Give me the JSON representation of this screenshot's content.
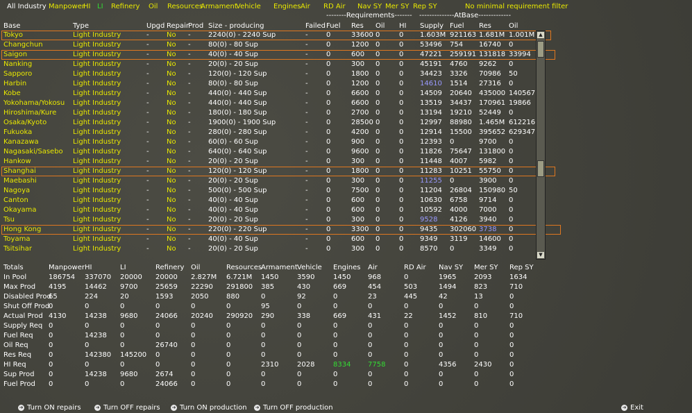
{
  "filter": {
    "all_industry": "All Industry",
    "manpower": "Manpower",
    "hi": "HI",
    "li": "LI",
    "refinery": "Refinery",
    "oil": "Oil",
    "resources": "Resources",
    "armament": "Armament",
    "vehicle": "Vehicle",
    "engines": "Engines",
    "air": "Air",
    "rd_air": "RD Air",
    "nav_sy": "Nav SY",
    "mer_sy": "Mer SY",
    "rep_sy": "Rep SY",
    "min_req": "No minimal requirement filter"
  },
  "groups": {
    "requirements": "--------Requirements-------",
    "atbase": "--------------AtBase-------------"
  },
  "headers": [
    "Base",
    "Type",
    "Upgd",
    "Repair",
    "Prod",
    "Size - producing",
    "Failed",
    "Fuel",
    "Res",
    "Oil",
    "HI",
    "Supply",
    "Fuel",
    "Res",
    "Oil"
  ],
  "rows": [
    {
      "base": "Tokyo",
      "type": "Light Industry",
      "upgd": "-",
      "repair": "No",
      "prod": "-",
      "size": "2240(0) - 2240 Sup",
      "failed": "-",
      "fuel": "0",
      "res": "33600",
      "oil": "0",
      "hi": "0",
      "supply": "1.603M",
      "afuel": "921163",
      "ares": "1.681M",
      "aoil": "1.001M",
      "sel": true
    },
    {
      "base": "Changchun",
      "type": "Light Industry",
      "upgd": "-",
      "repair": "No",
      "prod": "-",
      "size": "80(0) - 80 Sup",
      "failed": "-",
      "fuel": "0",
      "res": "1200",
      "oil": "0",
      "hi": "0",
      "supply": "53496",
      "afuel": "754",
      "ares": "16740",
      "aoil": "0"
    },
    {
      "base": "Saigon",
      "type": "Light Industry",
      "upgd": "-",
      "repair": "No",
      "prod": "-",
      "size": "40(0) - 40 Sup",
      "failed": "-",
      "fuel": "0",
      "res": "600",
      "oil": "0",
      "hi": "0",
      "supply": "47221",
      "afuel": "259191",
      "ares": "131818",
      "aoil": "33994",
      "sel": true
    },
    {
      "base": "Nanking",
      "type": "Light Industry",
      "upgd": "-",
      "repair": "No",
      "prod": "-",
      "size": "20(0) - 20 Sup",
      "failed": "-",
      "fuel": "0",
      "res": "300",
      "oil": "0",
      "hi": "0",
      "supply": "45191",
      "afuel": "4760",
      "ares": "9262",
      "aoil": "0"
    },
    {
      "base": "Sapporo",
      "type": "Light Industry",
      "upgd": "-",
      "repair": "No",
      "prod": "-",
      "size": "120(0) - 120 Sup",
      "failed": "-",
      "fuel": "0",
      "res": "1800",
      "oil": "0",
      "hi": "0",
      "supply": "34423",
      "afuel": "3326",
      "ares": "70986",
      "aoil": "50"
    },
    {
      "base": "Harbin",
      "type": "Light Industry",
      "upgd": "-",
      "repair": "No",
      "prod": "-",
      "size": "80(0) - 80 Sup",
      "failed": "-",
      "fuel": "0",
      "res": "1200",
      "oil": "0",
      "hi": "0",
      "supply": "14610",
      "afuel": "1514",
      "ares": "27316",
      "aoil": "0",
      "supply_blue": true
    },
    {
      "base": "Kobe",
      "type": "Light Industry",
      "upgd": "-",
      "repair": "No",
      "prod": "-",
      "size": "440(0) - 440 Sup",
      "failed": "-",
      "fuel": "0",
      "res": "6600",
      "oil": "0",
      "hi": "0",
      "supply": "14509",
      "afuel": "20640",
      "ares": "435000",
      "aoil": "140567"
    },
    {
      "base": "Yokohama/Yokosu",
      "type": "Light Industry",
      "upgd": "-",
      "repair": "No",
      "prod": "-",
      "size": "440(0) - 440 Sup",
      "failed": "-",
      "fuel": "0",
      "res": "6600",
      "oil": "0",
      "hi": "0",
      "supply": "13519",
      "afuel": "34437",
      "ares": "170961",
      "aoil": "19866"
    },
    {
      "base": "Hiroshima/Kure",
      "type": "Light Industry",
      "upgd": "-",
      "repair": "No",
      "prod": "-",
      "size": "180(0) - 180 Sup",
      "failed": "-",
      "fuel": "0",
      "res": "2700",
      "oil": "0",
      "hi": "0",
      "supply": "13194",
      "afuel": "19210",
      "ares": "52449",
      "aoil": "0"
    },
    {
      "base": "Osaka/Kyoto",
      "type": "Light Industry",
      "upgd": "-",
      "repair": "No",
      "prod": "-",
      "size": "1900(0) - 1900 Sup",
      "failed": "-",
      "fuel": "0",
      "res": "28500",
      "oil": "0",
      "hi": "0",
      "supply": "12997",
      "afuel": "88980",
      "ares": "1.465M",
      "aoil": "612216"
    },
    {
      "base": "Fukuoka",
      "type": "Light Industry",
      "upgd": "-",
      "repair": "No",
      "prod": "-",
      "size": "280(0) - 280 Sup",
      "failed": "-",
      "fuel": "0",
      "res": "4200",
      "oil": "0",
      "hi": "0",
      "supply": "12914",
      "afuel": "15500",
      "ares": "395652",
      "aoil": "629347"
    },
    {
      "base": "Kanazawa",
      "type": "Light Industry",
      "upgd": "-",
      "repair": "No",
      "prod": "-",
      "size": "60(0) - 60 Sup",
      "failed": "-",
      "fuel": "0",
      "res": "900",
      "oil": "0",
      "hi": "0",
      "supply": "12393",
      "afuel": "0",
      "ares": "9700",
      "aoil": "0"
    },
    {
      "base": "Nagasaki/Sasebo",
      "type": "Light Industry",
      "upgd": "-",
      "repair": "No",
      "prod": "-",
      "size": "640(0) - 640 Sup",
      "failed": "-",
      "fuel": "0",
      "res": "9600",
      "oil": "0",
      "hi": "0",
      "supply": "11826",
      "afuel": "75647",
      "ares": "131800",
      "aoil": "0"
    },
    {
      "base": "Hankow",
      "type": "Light Industry",
      "upgd": "-",
      "repair": "No",
      "prod": "-",
      "size": "20(0) - 20 Sup",
      "failed": "-",
      "fuel": "0",
      "res": "300",
      "oil": "0",
      "hi": "0",
      "supply": "11448",
      "afuel": "4007",
      "ares": "5982",
      "aoil": "0"
    },
    {
      "base": "Shanghai",
      "type": "Light Industry",
      "upgd": "-",
      "repair": "No",
      "prod": "-",
      "size": "120(0) - 120 Sup",
      "failed": "-",
      "fuel": "0",
      "res": "1800",
      "oil": "0",
      "hi": "0",
      "supply": "11283",
      "afuel": "10251",
      "ares": "55750",
      "aoil": "0",
      "sel": true
    },
    {
      "base": "Maebashi",
      "type": "Light Industry",
      "upgd": "-",
      "repair": "No",
      "prod": "-",
      "size": "20(0) - 20 Sup",
      "failed": "-",
      "fuel": "0",
      "res": "300",
      "oil": "0",
      "hi": "0",
      "supply": "11255",
      "afuel": "0",
      "ares": "3900",
      "aoil": "0",
      "supply_blue": true
    },
    {
      "base": "Nagoya",
      "type": "Light Industry",
      "upgd": "-",
      "repair": "No",
      "prod": "-",
      "size": "500(0) - 500 Sup",
      "failed": "-",
      "fuel": "0",
      "res": "7500",
      "oil": "0",
      "hi": "0",
      "supply": "11204",
      "afuel": "26804",
      "ares": "150980",
      "aoil": "50"
    },
    {
      "base": "Canton",
      "type": "Light Industry",
      "upgd": "-",
      "repair": "No",
      "prod": "-",
      "size": "40(0) - 40 Sup",
      "failed": "-",
      "fuel": "0",
      "res": "600",
      "oil": "0",
      "hi": "0",
      "supply": "10630",
      "afuel": "6758",
      "ares": "9714",
      "aoil": "0"
    },
    {
      "base": "Okayama",
      "type": "Light Industry",
      "upgd": "-",
      "repair": "No",
      "prod": "-",
      "size": "40(0) - 40 Sup",
      "failed": "-",
      "fuel": "0",
      "res": "600",
      "oil": "0",
      "hi": "0",
      "supply": "10592",
      "afuel": "4000",
      "ares": "7000",
      "aoil": "0"
    },
    {
      "base": "Tsu",
      "type": "Light Industry",
      "upgd": "-",
      "repair": "No",
      "prod": "-",
      "size": "20(0) - 20 Sup",
      "failed": "-",
      "fuel": "0",
      "res": "300",
      "oil": "0",
      "hi": "0",
      "supply": "9528",
      "afuel": "4126",
      "ares": "3940",
      "aoil": "0",
      "supply_blue": true
    },
    {
      "base": "Hong Kong",
      "type": "Light Industry",
      "upgd": "-",
      "repair": "No",
      "prod": "-",
      "size": "220(0) - 220 Sup",
      "failed": "-",
      "fuel": "0",
      "res": "3300",
      "oil": "0",
      "hi": "0",
      "supply": "9435",
      "afuel": "302060",
      "ares": "3738",
      "aoil": "0",
      "sel": true,
      "ares_blue": true
    },
    {
      "base": "Toyama",
      "type": "Light Industry",
      "upgd": "-",
      "repair": "No",
      "prod": "-",
      "size": "40(0) - 40 Sup",
      "failed": "-",
      "fuel": "0",
      "res": "600",
      "oil": "0",
      "hi": "0",
      "supply": "9349",
      "afuel": "3119",
      "ares": "14600",
      "aoil": "0"
    },
    {
      "base": "Tsitsihar",
      "type": "Light Industry",
      "upgd": "-",
      "repair": "No",
      "prod": "-",
      "size": "20(0) - 20 Sup",
      "failed": "-",
      "fuel": "0",
      "res": "300",
      "oil": "0",
      "hi": "0",
      "supply": "8570",
      "afuel": "0",
      "ares": "3349",
      "aoil": "0"
    }
  ],
  "totals": {
    "headers": [
      "Totals",
      "Manpower",
      "HI",
      "LI",
      "Refinery",
      "Oil",
      "Resources",
      "Armament",
      "Vehicle",
      "Engines",
      "Air",
      "RD Air",
      "Nav SY",
      "Mer SY",
      "Rep SY"
    ],
    "rows": [
      {
        "label": "In Pool",
        "vals": [
          "186754",
          "337070",
          "20000",
          "20000",
          "2.827M",
          "6.721M",
          "1450",
          "3590",
          "1450",
          "968",
          "0",
          "1965",
          "2093",
          "1634"
        ]
      },
      {
        "label": "Max Prod",
        "vals": [
          "4195",
          "14462",
          "9700",
          "25659",
          "22290",
          "291800",
          "385",
          "430",
          "669",
          "454",
          "503",
          "1494",
          "823",
          "710"
        ]
      },
      {
        "label": "Disabled Prod",
        "vals": [
          "65",
          "224",
          "20",
          "1593",
          "2050",
          "880",
          "0",
          "92",
          "0",
          "23",
          "445",
          "42",
          "13",
          "0"
        ]
      },
      {
        "label": "Shut Off Prod",
        "vals": [
          "0",
          "0",
          "0",
          "0",
          "0",
          "0",
          "95",
          "0",
          "0",
          "0",
          "0",
          "0",
          "0",
          "0"
        ]
      },
      {
        "label": "Actual Prod",
        "vals": [
          "4130",
          "14238",
          "9680",
          "24066",
          "20240",
          "290920",
          "290",
          "338",
          "669",
          "431",
          "22",
          "1452",
          "810",
          "710"
        ]
      },
      {
        "label": "Supply Req",
        "vals": [
          "0",
          "0",
          "0",
          "0",
          "0",
          "0",
          "0",
          "0",
          "0",
          "0",
          "0",
          "0",
          "0",
          "0"
        ]
      },
      {
        "label": "Fuel Req",
        "vals": [
          "0",
          "14238",
          "0",
          "0",
          "0",
          "0",
          "0",
          "0",
          "0",
          "0",
          "0",
          "0",
          "0",
          "0"
        ]
      },
      {
        "label": "Oil Req",
        "vals": [
          "0",
          "0",
          "0",
          "26740",
          "0",
          "0",
          "0",
          "0",
          "0",
          "0",
          "0",
          "0",
          "0",
          "0"
        ]
      },
      {
        "label": "Res Req",
        "vals": [
          "0",
          "142380",
          "145200",
          "0",
          "0",
          "0",
          "0",
          "0",
          "0",
          "0",
          "0",
          "0",
          "0",
          "0"
        ]
      },
      {
        "label": "HI Req",
        "vals": [
          "0",
          "0",
          "0",
          "0",
          "0",
          "0",
          "2310",
          "2028",
          "8334",
          "7758",
          "0",
          "4356",
          "2430",
          "0"
        ]
      },
      {
        "label": "Sup Prod",
        "vals": [
          "0",
          "14238",
          "9680",
          "2674",
          "0",
          "0",
          "0",
          "0",
          "0",
          "0",
          "0",
          "0",
          "0",
          "0"
        ]
      },
      {
        "label": "Fuel Prod",
        "vals": [
          "0",
          "0",
          "0",
          "24066",
          "0",
          "0",
          "0",
          "0",
          "0",
          "0",
          "0",
          "0",
          "0",
          "0"
        ]
      }
    ]
  },
  "buttons": {
    "turn_on_repairs": "Turn ON repairs",
    "turn_off_repairs": "Turn OFF repairs",
    "turn_on_production": "Turn ON production",
    "turn_off_production": "Turn OFF production",
    "exit": "Exit"
  },
  "colors": {
    "yellow": "#e8e800",
    "white": "#ffffff",
    "blue": "#9a9aff",
    "green": "#33dd33",
    "highlight": "#e07820"
  }
}
